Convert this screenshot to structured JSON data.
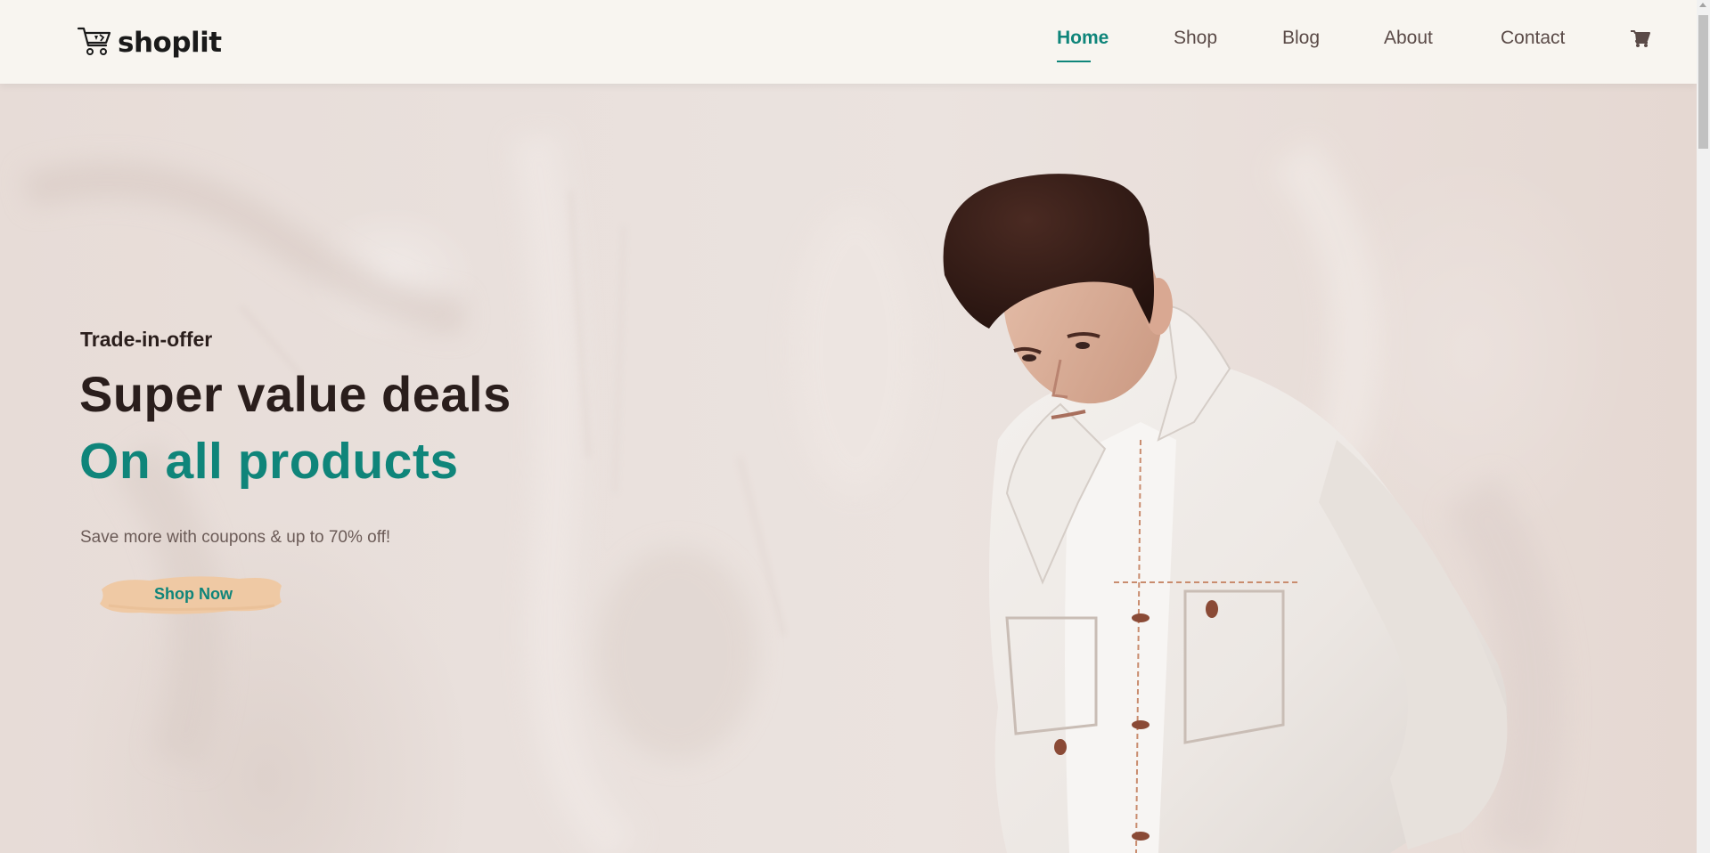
{
  "brand": {
    "name": "shoplit",
    "logo_icon": "cart-logo-icon"
  },
  "nav": {
    "items": [
      {
        "label": "Home",
        "active": true
      },
      {
        "label": "Shop",
        "active": false
      },
      {
        "label": "Blog",
        "active": false
      },
      {
        "label": "About",
        "active": false
      },
      {
        "label": "Contact",
        "active": false
      }
    ],
    "cart_icon": "shopping-cart-icon"
  },
  "hero": {
    "eyebrow": "Trade-in-offer",
    "headline_line1": "Super value deals",
    "headline_line2": "On all products",
    "subtext": "Save more with coupons & up to 70% off!",
    "cta_label": "Shop Now"
  },
  "colors": {
    "accent": "#0f857a",
    "header_bg": "#f8f5f0",
    "heading_text": "#2a1e1c",
    "cta_brush": "#efc9a4",
    "hero_bg": "#e9e0dc"
  }
}
